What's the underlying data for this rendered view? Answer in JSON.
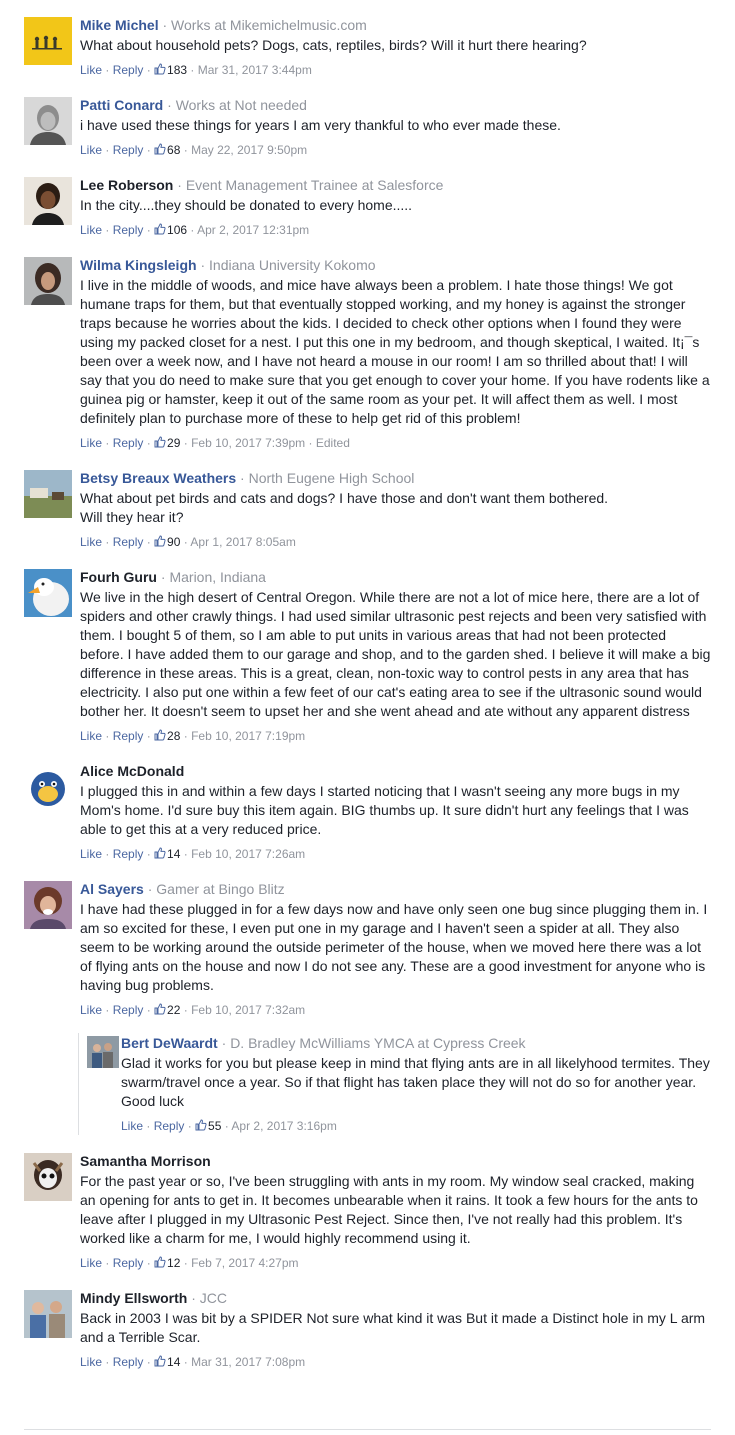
{
  "actions": {
    "like": "Like",
    "reply": "Reply",
    "sep": "·"
  },
  "colors": {
    "author": "#385898",
    "meta": "#90949c",
    "link": "#4b67a1"
  },
  "comments": [
    {
      "author": "Mike Michel",
      "sub": "Works at Mikemichelmusic.com",
      "text": "What about household pets? Dogs, cats, reptiles, birds? Will it hurt there hearing?",
      "likes": "183",
      "time": "Mar 31, 2017 3:44pm",
      "edited": "",
      "avatar": "yellow-logo"
    },
    {
      "author": "Patti Conard",
      "sub": "Works at Not needed",
      "text": "i have used these things for years I am very thankful to who ever made these.",
      "likes": "68",
      "time": "May 22, 2017 9:50pm",
      "edited": "",
      "avatar": "portrait"
    },
    {
      "author": "Lee Roberson",
      "sub": "Event Management Trainee at Salesforce",
      "text": "In the city....they should be donated to every home.....",
      "likes": "106",
      "time": "Apr 2, 2017 12:31pm",
      "edited": "",
      "avatar": "portrait"
    },
    {
      "author": "Wilma Kingsleigh",
      "sub": "Indiana University Kokomo",
      "text": "I live in the middle of woods, and mice have always been a problem. I hate those things! We got humane traps for them, but that eventually stopped working, and my honey is against the stronger traps because he worries about the kids. I decided to check other options when I found they were using my packed closet for a nest. I put this one in my bedroom, and though skeptical, I waited. It¡¯s been over a week now, and I have not heard a mouse in our room! I am so thrilled about that! I will say that you do need to make sure that you get enough to cover your home. If you have rodents like a guinea pig or hamster, keep it out of the same room as your pet. It will affect them as well. I most definitely plan to purchase more of these to help get rid of this problem!",
      "likes": "29",
      "time": "Feb 10, 2017 7:39pm",
      "edited": "Edited",
      "avatar": "portrait"
    },
    {
      "author": "Betsy Breaux Weathers",
      "sub": "North Eugene High School",
      "text": "What about pet birds and cats and dogs? I have those and don't want them bothered.\nWill they hear it?",
      "likes": "90",
      "time": "Apr 1, 2017 8:05am",
      "edited": "",
      "avatar": "landscape"
    },
    {
      "author": "Fourh Guru",
      "sub": "Marion, Indiana",
      "text": "We live in the high desert of Central Oregon. While there are not a lot of mice here, there are a lot of spiders and other crawly things. I had used similar ultrasonic pest rejects and been very satisfied with them. I bought 5 of them, so I am able to put units in various areas that had not been protected before. I have added them to our garage and shop, and to the garden shed. I believe it will make a big difference in these areas. This is a great, clean, non-toxic way to control pests in any area that has electricity. I also put one within a few feet of our cat's eating area to see if the ultrasonic sound would bother her. It doesn't seem to upset her and she went ahead and ate without any apparent distress",
      "likes": "28",
      "time": "Feb 10, 2017 7:19pm",
      "edited": "",
      "avatar": "duck"
    },
    {
      "author": "Alice McDonald",
      "sub": "",
      "text": "I plugged this in and within a few days I started noticing that I wasn't seeing any more bugs in my Mom's home. I'd sure buy this item again. BIG thumbs up. It sure didn't hurt any feelings that I was able to get this at a very reduced price.",
      "likes": "14",
      "time": "Feb 10, 2017 7:26am",
      "edited": "",
      "avatar": "cartoon"
    },
    {
      "author": "Al Sayers",
      "sub": "Gamer at Bingo Blitz",
      "text": "I have had these plugged in for a few days now and have only seen one bug since plugging them in. I am so excited for these, I even put one in my garage and I haven't seen a spider at all. They also seem to be working around the outside perimeter of the house, when we moved here there was a lot of flying ants on the house and now I do not see any. These are a good investment for anyone who is having bug problems.",
      "likes": "22",
      "time": "Feb 10, 2017 7:32am",
      "edited": "",
      "avatar": "portrait"
    }
  ],
  "reply": {
    "author": "Bert DeWaardt",
    "sub": "D. Bradley McWilliams YMCA at Cypress Creek",
    "text": "Glad it works for you but please keep in mind that flying ants are in all likelyhood termites. They swarm/travel once a year. So if that flight has taken place they will not do so for another year.\nGood luck",
    "likes": "55",
    "time": "Apr 2, 2017 3:16pm",
    "avatar": "group"
  },
  "comments_after": [
    {
      "author": "Samantha Morrison",
      "sub": "",
      "text": "For the past year or so, I've been struggling with ants in my room. My window seal cracked, making an opening for ants to get in. It becomes unbearable when it rains. It took a few hours for the ants to leave after I plugged in my Ultrasonic Pest Reject. Since then, I've not really had this problem. It's worked like a charm for me, I would highly recommend using it.",
      "likes": "12",
      "time": "Feb 7, 2017 4:27pm",
      "avatar": "mask"
    },
    {
      "author": "Mindy Ellsworth",
      "sub": "JCC",
      "text": "Back in 2003 I was bit by a SPIDER Not sure what kind it was But it made a Distinct hole in my L arm and a Terrible Scar.",
      "likes": "14",
      "time": "Mar 31, 2017 7:08pm",
      "avatar": "group"
    }
  ]
}
